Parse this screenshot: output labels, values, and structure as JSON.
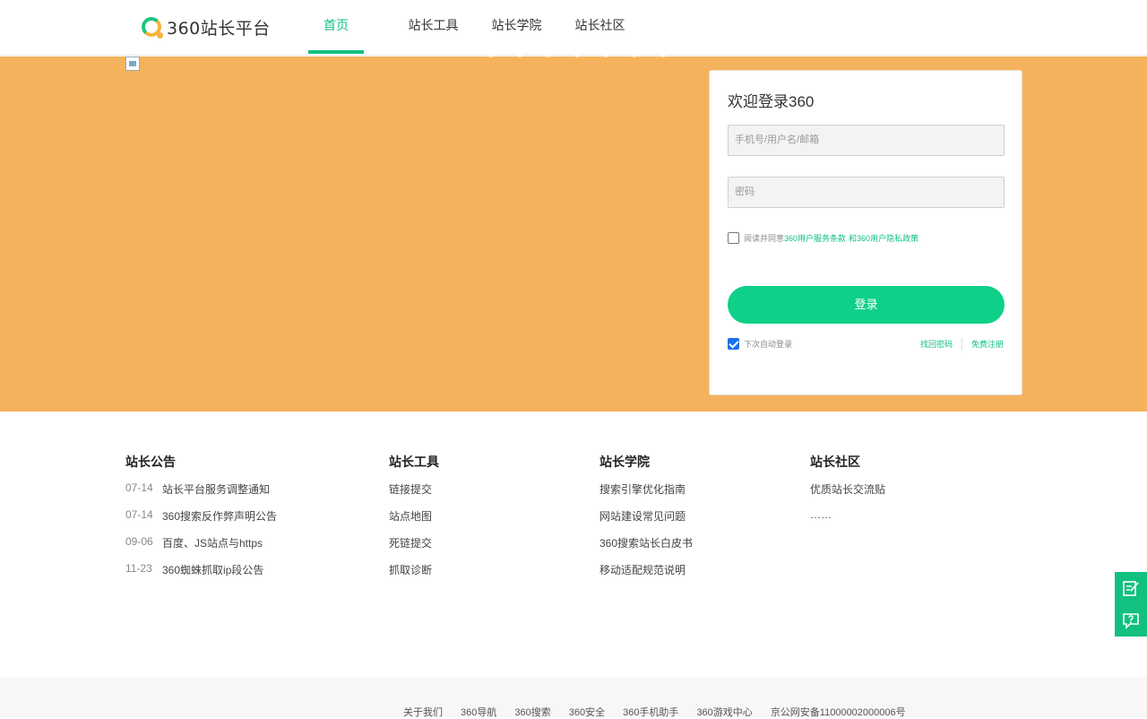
{
  "header": {
    "logo_text": "360站长平台",
    "nav": [
      {
        "label": "首页",
        "active": true
      },
      {
        "label": "站长工具"
      },
      {
        "label": "站长学院"
      },
      {
        "label": "站长社区"
      }
    ]
  },
  "login": {
    "title": "欢迎登录360",
    "username_placeholder": "手机号/用户名/邮箱",
    "password_placeholder": "密码",
    "agree_prefix": "阅读并同意",
    "agree_link1": "360用户服务条款",
    "agree_link2": "和360用户隐私政策",
    "submit_label": "登录",
    "remember_label": "下次自动登录",
    "forgot_label": "找回密码",
    "register_label": "免费注册"
  },
  "sections": {
    "announcements": {
      "title": "站长公告",
      "items": [
        {
          "date": "07-14",
          "text": "站长平台服务调整通知"
        },
        {
          "date": "07-14",
          "text": "360搜索反作弊声明公告"
        },
        {
          "date": "09-06",
          "text": "百度、JS站点与https"
        },
        {
          "date": "11-23",
          "text": "360蜘蛛抓取ip段公告"
        }
      ]
    },
    "tools": {
      "title": "站长工具",
      "items": [
        "链接提交",
        "站点地图",
        "死链提交",
        "抓取诊断"
      ]
    },
    "academy": {
      "title": "站长学院",
      "items": [
        "搜索引擎优化指南",
        "网站建设常见问题",
        "360搜索站长白皮书",
        "移动适配规范说明"
      ]
    },
    "community": {
      "title": "站长社区",
      "items": [
        "优质站长交流贴",
        "……"
      ]
    }
  },
  "footer": {
    "links": [
      "关于我们",
      "360导航",
      "360搜索",
      "360安全",
      "360手机助手",
      "360游戏中心",
      "京公网安备11000002000006号"
    ]
  },
  "colors": {
    "accent": "#12c07f",
    "banner": "#f5b25c",
    "button": "#0fd088"
  },
  "icons": {
    "feedback": "edit-note-icon",
    "help": "question-bubble-icon"
  }
}
